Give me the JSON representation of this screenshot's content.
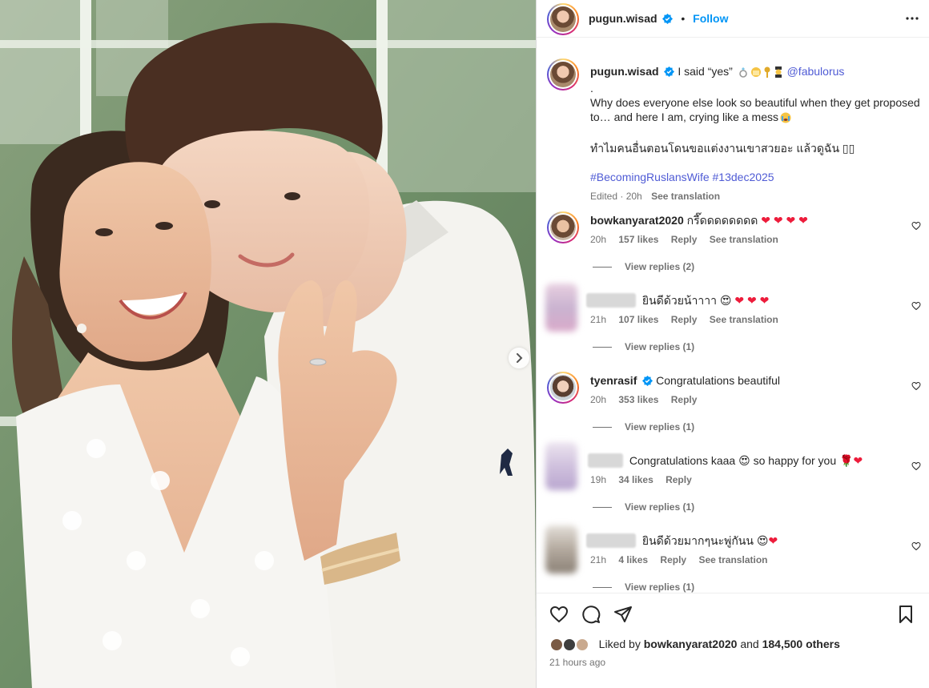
{
  "post": {
    "username": "pugun.wisad",
    "follow_label": "Follow",
    "dot": "•",
    "more_icon": "more-horizontal-icon"
  },
  "caption": {
    "username": "pugun.wisad",
    "line1": "I said “yes”",
    "mention": "@fabulorus",
    "dot_line": ".",
    "body": "Why does everyone else look so beautiful when they get proposed to… and here I am, crying like a mess",
    "thai": "ทำไมคนอื่นตอนโดนขอแต่งงานเขาสวยอะ แล้วดูฉัน ▯▯",
    "hashtags": "#BecomingRuslansWife #13dec2025",
    "edited": "Edited · 20h",
    "see_translation": "See translation"
  },
  "comments": [
    {
      "user": "bowkanyarat2020",
      "text": "กรี๊ดดดดดดดด",
      "time": "20h",
      "likes": "157 likes",
      "reply": "Reply",
      "translate": "See translation",
      "view": "View replies (2)"
    },
    {
      "user": "",
      "text": "ยินดีด้วยน้าาาา",
      "time": "21h",
      "likes": "107 likes",
      "reply": "Reply",
      "translate": "See translation",
      "view": "View replies (1)"
    },
    {
      "user": "tyenrasif",
      "text": "Congratulations beautiful",
      "time": "20h",
      "likes": "353 likes",
      "reply": "Reply",
      "translate": "",
      "view": "View replies (1)"
    },
    {
      "user": "",
      "text": "Congratulations kaaa",
      "text2": "so happy for you",
      "time": "19h",
      "likes": "34 likes",
      "reply": "Reply",
      "translate": "",
      "view": "View replies (1)"
    },
    {
      "user": "",
      "text": "ยินดีด้วยมากๆนะพู่กันน",
      "time": "21h",
      "likes": "4 likes",
      "reply": "Reply",
      "translate": "See translation",
      "view": "View replies (1)"
    }
  ],
  "footer": {
    "liked_by": "Liked by",
    "liked_user": "bowkanyarat2020",
    "and": "and",
    "others": "184,500 others",
    "posted": "21 hours ago"
  },
  "colors": {
    "accent": "#0095f6",
    "link": "#4f5bd5",
    "heart": "#ed1c3b",
    "secondary_text": "#737373"
  }
}
